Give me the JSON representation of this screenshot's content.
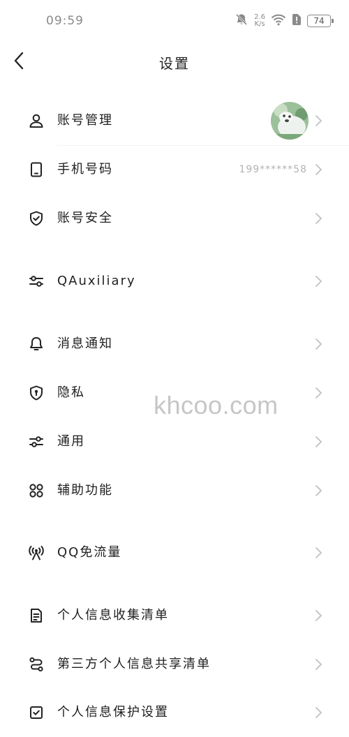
{
  "status_bar": {
    "time": "09:59",
    "net_speed_value": "2.6",
    "net_speed_unit": "K/s",
    "battery": "74",
    "icons": [
      "bell-off-icon",
      "wifi-icon",
      "sim-alert-icon",
      "battery-icon"
    ]
  },
  "header": {
    "title": "设置",
    "back_icon": "chevron-left-icon"
  },
  "settings": {
    "account": {
      "label": "账号管理",
      "icon": "person-icon",
      "has_avatar": true
    },
    "phone": {
      "label": "手机号码",
      "icon": "phone-icon",
      "value": "199******58"
    },
    "security": {
      "label": "账号安全",
      "icon": "shield-check-icon"
    },
    "qauxiliary": {
      "label": "QAuxiliary",
      "icon": "sliders-icon"
    },
    "notifications": {
      "label": "消息通知",
      "icon": "bell-icon"
    },
    "privacy": {
      "label": "隐私",
      "icon": "privacy-shield-icon"
    },
    "general": {
      "label": "通用",
      "icon": "sliders-icon"
    },
    "accessibility": {
      "label": "辅助功能",
      "icon": "grid-icon"
    },
    "free_data": {
      "label": "QQ免流量",
      "icon": "signal-tower-icon"
    },
    "collection_list": {
      "label": "个人信息收集清单",
      "icon": "document-icon"
    },
    "third_party_list": {
      "label": "第三方个人信息共享清单",
      "icon": "share-route-icon"
    },
    "protection": {
      "label": "个人信息保护设置",
      "icon": "checkbox-icon"
    }
  },
  "watermark": "khcoo.com",
  "colors": {
    "background": "#ffffff",
    "text": "#1f1f1f",
    "secondary": "#b3b3b3",
    "chevron": "#c0c0c0"
  }
}
